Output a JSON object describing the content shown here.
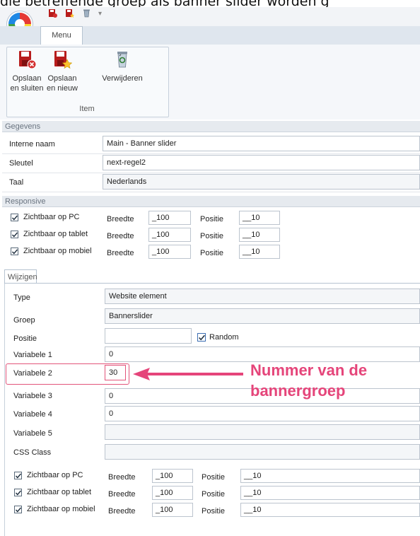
{
  "top_text": "die betreffende groep als banner slider worden g",
  "ribbon": {
    "tab_label": "Menu",
    "buttons": [
      {
        "label": "Opslaan\nen sluiten",
        "icon": "save-close-icon"
      },
      {
        "label": "Opslaan\nen nieuw",
        "icon": "save-new-icon"
      },
      {
        "label": "Verwijderen",
        "icon": "recycle-bin-icon"
      }
    ],
    "group_label": "Item"
  },
  "gegevens": {
    "title": "Gegevens",
    "rows": [
      {
        "label": "Interne naam",
        "value": "Main - Banner slider"
      },
      {
        "label": "Sleutel",
        "value": "next-regel2"
      },
      {
        "label": "Taal",
        "value": "Nederlands"
      }
    ]
  },
  "responsive": {
    "title": "Responsive",
    "rows": [
      {
        "label": "Zichtbaar op PC",
        "checked": true,
        "breedte_label": "Breedte",
        "breedte": "_100",
        "positie_label": "Positie",
        "positie": "__10"
      },
      {
        "label": "Zichtbaar op tablet",
        "checked": true,
        "breedte_label": "Breedte",
        "breedte": "_100",
        "positie_label": "Positie",
        "positie": "__10"
      },
      {
        "label": "Zichtbaar op mobiel",
        "checked": true,
        "breedte_label": "Breedte",
        "breedte": "_100",
        "positie_label": "Positie",
        "positie": "__10"
      }
    ]
  },
  "wijzigen": {
    "tab_label": "Wijzigen",
    "type_label": "Type",
    "type_value": "Website element",
    "groep_label": "Groep",
    "groep_value": "Bannerslider",
    "positie_label": "Positie",
    "positie_value": "",
    "random_label": "Random",
    "random_checked": true,
    "var1_label": "Variabele 1",
    "var1_value": "0",
    "var2_label": "Variabele 2",
    "var2_value": "30",
    "var3_label": "Variabele 3",
    "var3_value": "0",
    "var4_label": "Variabele 4",
    "var4_value": "0",
    "var5_label": "Variabele 5",
    "var5_value": "",
    "css_label": "CSS Class",
    "css_value": "",
    "rows": [
      {
        "label": "Zichtbaar op PC",
        "checked": true,
        "breedte_label": "Breedte",
        "breedte": "_100",
        "positie_label": "Positie",
        "positie": "__10"
      },
      {
        "label": "Zichtbaar op tablet",
        "checked": true,
        "breedte_label": "Breedte",
        "breedte": "_100",
        "positie_label": "Positie",
        "positie": "__10"
      },
      {
        "label": "Zichtbaar op mobiel",
        "checked": true,
        "breedte_label": "Breedte",
        "breedte": "_100",
        "positie_label": "Positie",
        "positie": "__10"
      }
    ]
  },
  "annotation": {
    "line1": "Nummer van de",
    "line2": "bannergroep",
    "color": "#e5457a"
  }
}
